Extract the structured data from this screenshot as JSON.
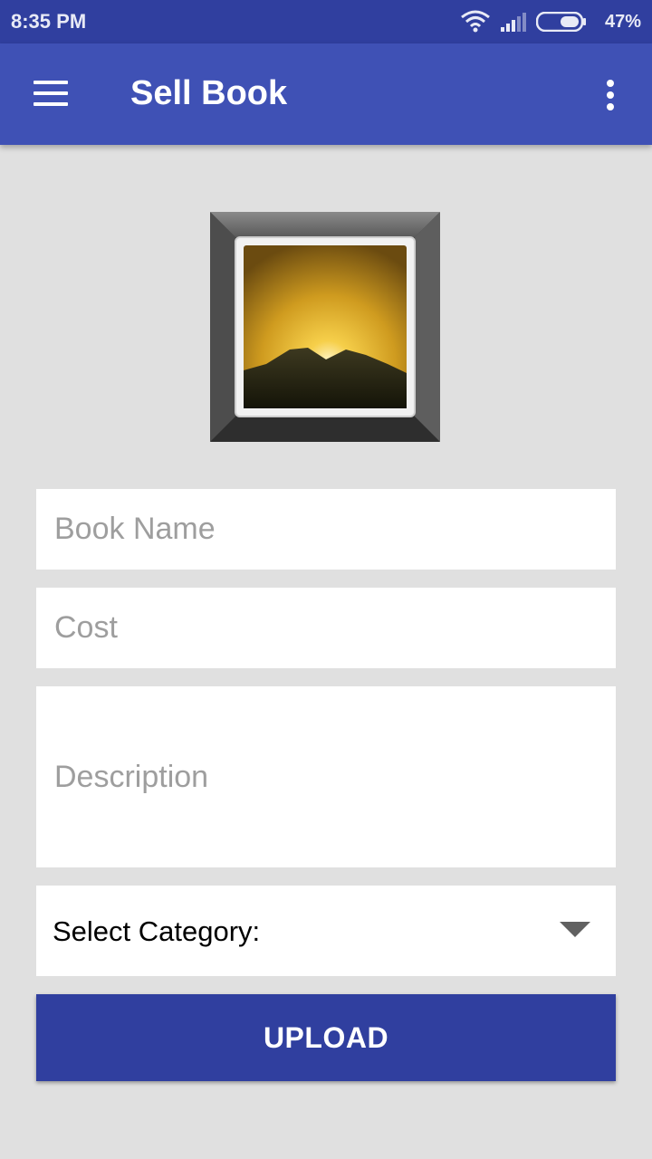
{
  "status_bar": {
    "time": "8:35 PM",
    "battery": "47%",
    "icons": [
      "wifi-icon",
      "signal-icon",
      "battery-icon"
    ]
  },
  "app_bar": {
    "title": "Sell Book",
    "icons": [
      "menu-icon",
      "overflow-menu-icon"
    ]
  },
  "form": {
    "image_picker_icon": "image-placeholder-icon",
    "book_name_placeholder": "Book Name",
    "cost_placeholder": "Cost",
    "description_placeholder": "Description",
    "category_label": "Select Category:",
    "upload_label": "UPLOAD"
  },
  "colors": {
    "status_bar": "#303f9f",
    "app_bar": "#3f51b5",
    "button": "#303f9f",
    "background": "#e0e0e0"
  }
}
